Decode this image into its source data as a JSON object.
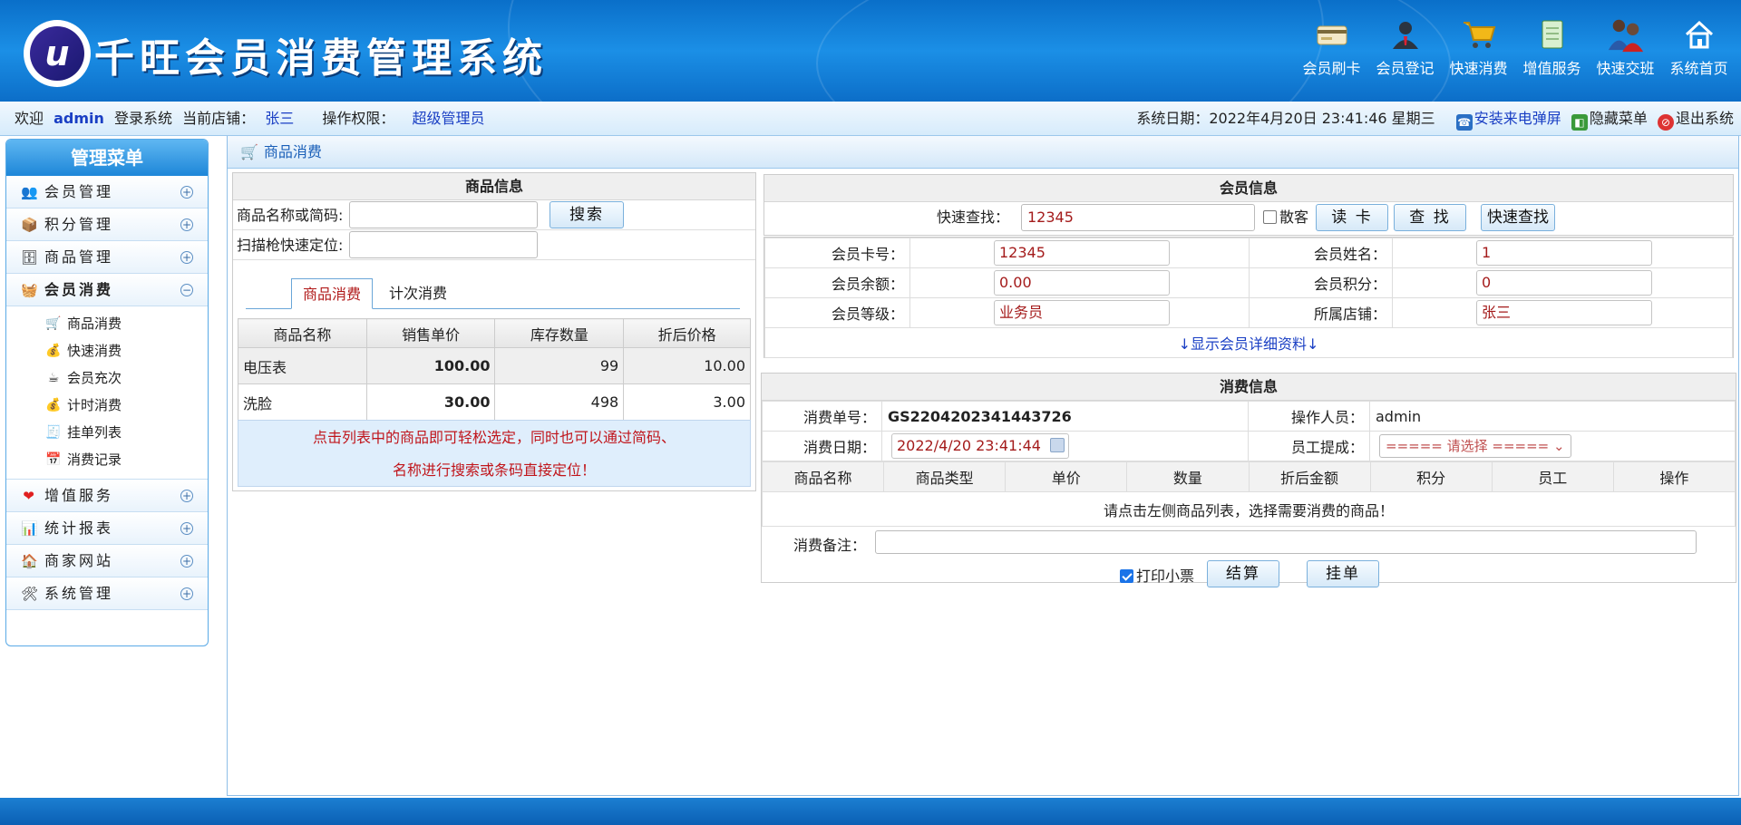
{
  "header": {
    "logo_letter": "u",
    "app_title": "千旺会员消费管理系统",
    "nav": [
      {
        "label": "会员刷卡",
        "icon": "card-reader-icon"
      },
      {
        "label": "会员登记",
        "icon": "member-register-icon"
      },
      {
        "label": "快速消费",
        "icon": "shopping-cart-icon"
      },
      {
        "label": "增值服务",
        "icon": "notepad-icon"
      },
      {
        "label": "快速交班",
        "icon": "shift-change-icon"
      },
      {
        "label": "系统首页",
        "icon": "home-icon"
      }
    ]
  },
  "infobar": {
    "welcome": "欢迎",
    "user": "admin",
    "login_text": "登录系统",
    "store_label": "当前店铺：",
    "store": "张三",
    "perm_label": "操作权限：",
    "perm": "超级管理员",
    "date_label": "系统日期：",
    "date": "2022年4月20日 23:41:46 星期三",
    "install_popup": "安装来电弹屏",
    "hide_menu": "隐藏菜单",
    "logout": "退出系统"
  },
  "sidebar": {
    "title": "管理菜单",
    "groups": [
      {
        "label": "会员管理",
        "toggle": "+"
      },
      {
        "label": "积分管理",
        "toggle": "+"
      },
      {
        "label": "商品管理",
        "toggle": "+"
      },
      {
        "label": "会员消费",
        "toggle": "−"
      },
      {
        "label": "增值服务",
        "toggle": "+"
      },
      {
        "label": "统计报表",
        "toggle": "+"
      },
      {
        "label": "商家网站",
        "toggle": "+"
      },
      {
        "label": "系统管理",
        "toggle": "+"
      }
    ],
    "sub_items": [
      "商品消费",
      "快速消费",
      "会员充次",
      "计时消费",
      "挂单列表",
      "消费记录"
    ]
  },
  "main": {
    "title": "商品消费"
  },
  "product_panel": {
    "title": "商品信息",
    "name_label": "商品名称或简码:",
    "search_button": "搜索",
    "scan_label": "扫描枪快速定位:",
    "tabs": [
      "商品消费",
      "计次消费"
    ],
    "columns": [
      "商品名称",
      "销售单价",
      "库存数量",
      "折后价格"
    ],
    "rows": [
      {
        "name": "电压表",
        "price": "100.00",
        "stock": "99",
        "discount": "10.00"
      },
      {
        "name": "洗脸",
        "price": "30.00",
        "stock": "498",
        "discount": "3.00"
      }
    ],
    "tip_line1": "点击列表中的商品即可轻松选定，同时也可以通过简码、",
    "tip_line2": "名称进行搜索或条码直接定位！"
  },
  "member_panel": {
    "title": "会员信息",
    "quick_label": "快速查找：",
    "quick_value": "12345",
    "guest_label": "散客",
    "read_card": "读 卡",
    "find": "查 找",
    "quick_find": "快速查找",
    "card_no_label": "会员卡号：",
    "card_no": "12345",
    "name_label": "会员姓名：",
    "name": "1",
    "balance_label": "会员余额：",
    "balance": "0.00",
    "points_label": "会员积分：",
    "points": "0",
    "level_label": "会员等级：",
    "level": "业务员",
    "store_label": "所属店铺：",
    "store": "张三",
    "detail_link": "↓显示会员详细资料↓"
  },
  "consume_panel": {
    "title": "消费信息",
    "order_label": "消费单号：",
    "order_no": "GS2204202341443726",
    "operator_label": "操作人员：",
    "operator": "admin",
    "date_label": "消费日期：",
    "date": "2022/4/20 23:41:44",
    "commission_label": "员工提成：",
    "commission_select": "===== 请选择 =====",
    "columns": [
      "商品名称",
      "商品类型",
      "单价",
      "数量",
      "折后金额",
      "积分",
      "员工",
      "操作"
    ],
    "empty_msg": "请点击左侧商品列表，选择需要消费的商品！",
    "remark_label": "消费备注：",
    "print_label": "打印小票",
    "checkout_button": "结算",
    "hold_button": "挂单"
  }
}
